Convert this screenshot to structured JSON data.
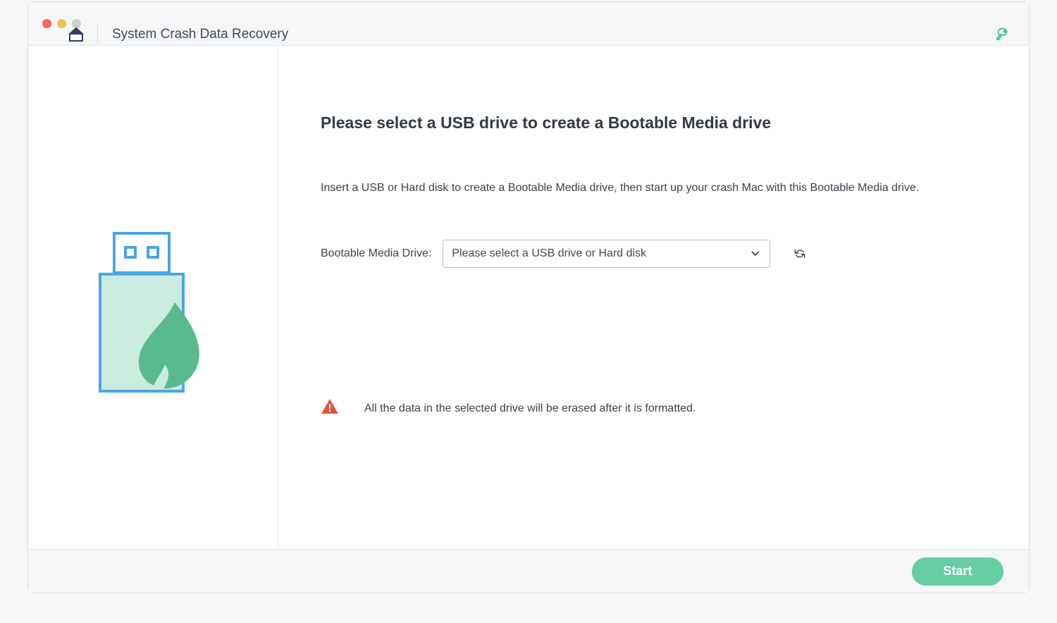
{
  "header": {
    "title": "System Crash Data Recovery"
  },
  "main": {
    "heading": "Please select a USB drive to create a Bootable Media drive",
    "instruction": "Insert a USB or Hard disk to create a Bootable Media drive, then start up your crash Mac with this Bootable Media drive.",
    "drive_label": "Bootable Media Drive:",
    "drive_select_placeholder": "Please select a USB drive or Hard disk",
    "warning": "All the data in the selected drive will be erased after it is formatted."
  },
  "footer": {
    "start_label": "Start"
  },
  "colors": {
    "accent": "#59c79e",
    "usb_stroke": "#4aa6e8",
    "usb_fill": "#c9ecdf",
    "warn": "#e2573b"
  }
}
